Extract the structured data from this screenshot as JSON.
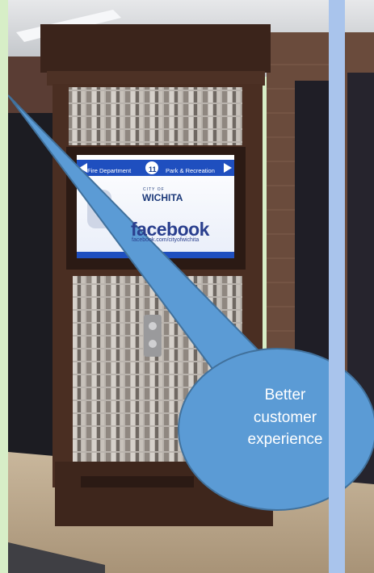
{
  "kiosk": {
    "nav_left": "Fire Department",
    "nav_number": "11",
    "nav_right": "Park & Recreation",
    "brand_small": "CITY OF",
    "brand": "WICHITA",
    "social_word": "facebook",
    "social_url": "facebook.com/cityofwichita"
  },
  "callout": {
    "line1": "Better",
    "line2": "customer",
    "line3": "experience",
    "fill_color": "#5b9bd5",
    "stroke_color": "#41719c"
  },
  "colors": {
    "frame_green": "#d7eec7",
    "divider_blue": "#a9c4ec",
    "wood": "#4a2e22"
  }
}
